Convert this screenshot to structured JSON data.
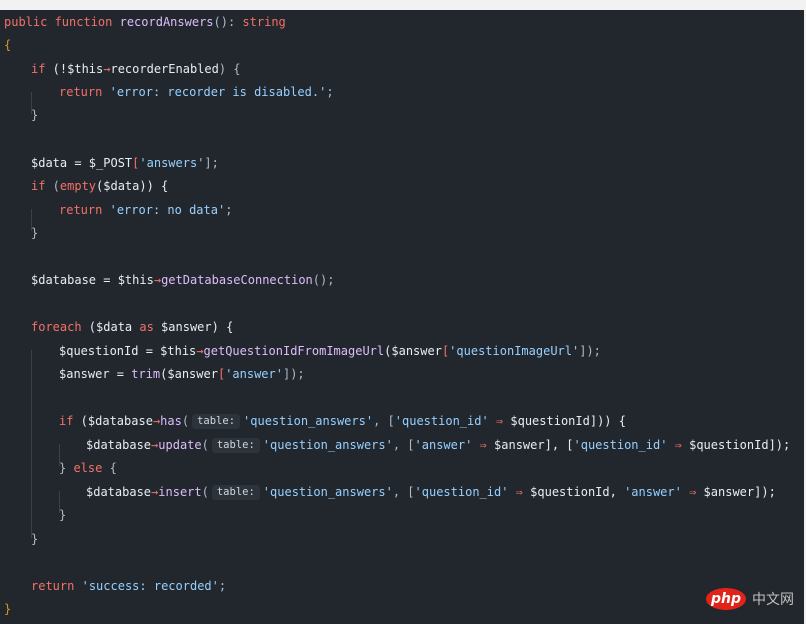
{
  "code": {
    "l1_a": "public function ",
    "l1_fn": "recordAnswers",
    "l1_b": "(): ",
    "l1_c": "string",
    "l2": "{",
    "l3_kw": "if",
    "l3_a": " (!$this",
    "l3_op": "→",
    "l3_b": "recorderEnabled",
    "l3_c": ") {",
    "l4_kw": "return",
    "l4_str": "'error: recorder is disabled.'",
    "l4_end": ";",
    "l5": "}",
    "l7_a": "$data = $_POST",
    "l7_b": "[",
    "l7_str": "'answers'",
    "l7_c": "];",
    "l8_kw": "if",
    "l8_a": " (",
    "l8_fn": "empty",
    "l8_b": "($data)) {",
    "l9_kw": "return",
    "l9_str": "'error: no data'",
    "l9_end": ";",
    "l10": "}",
    "l12_a": "$database = $this",
    "l12_op": "→",
    "l12_fn": "getDatabaseConnection",
    "l12_b": "();",
    "l14_kw": "foreach",
    "l14_a": " ($data ",
    "l14_kw2": "as",
    "l14_b": " $answer) {",
    "l15_a": "$questionId = $this",
    "l15_op": "→",
    "l15_fn": "getQuestionIdFromImageUrl",
    "l15_b": "($answer",
    "l15_c": "[",
    "l15_str": "'questionImageUrl'",
    "l15_d": "]);",
    "l16_a": "$answer = ",
    "l16_fn": "trim",
    "l16_b": "($answer",
    "l16_c": "[",
    "l16_str": "'answer'",
    "l16_d": "]);",
    "l18_kw": "if",
    "l18_a": " ($database",
    "l18_op": "→",
    "l18_fn": "has",
    "l18_b": "(",
    "l18_hint": "table:",
    "l18_str1": "'question_answers'",
    "l18_c": ", [",
    "l18_str2": "'question_id'",
    "l18_arrow": " ⇒ ",
    "l18_d": "$questionId])) {",
    "l19_a": "$database",
    "l19_op": "→",
    "l19_fn": "update",
    "l19_b": "(",
    "l19_hint": "table:",
    "l19_str1": "'question_answers'",
    "l19_c": ", [",
    "l19_str2": "'answer'",
    "l19_arrow1": " ⇒ ",
    "l19_d": "$answer], [",
    "l19_str3": "'question_id'",
    "l19_arrow2": " ⇒ ",
    "l19_e": "$questionId]);",
    "l20_a": "} ",
    "l20_kw": "else",
    "l20_b": " {",
    "l21_a": "$database",
    "l21_op": "→",
    "l21_fn": "insert",
    "l21_b": "(",
    "l21_hint": "table:",
    "l21_str1": "'question_answers'",
    "l21_c": ", [",
    "l21_str2": "'question_id'",
    "l21_arrow1": " ⇒ ",
    "l21_d": "$questionId, ",
    "l21_str3": "'answer'",
    "l21_arrow2": " ⇒ ",
    "l21_e": "$answer]);",
    "l22": "}",
    "l23": "}",
    "l25_kw": "return",
    "l25_str": "'success: recorded'",
    "l25_end": ";",
    "l26": "}"
  },
  "watermark": {
    "logo": "php",
    "text": "中文网"
  }
}
